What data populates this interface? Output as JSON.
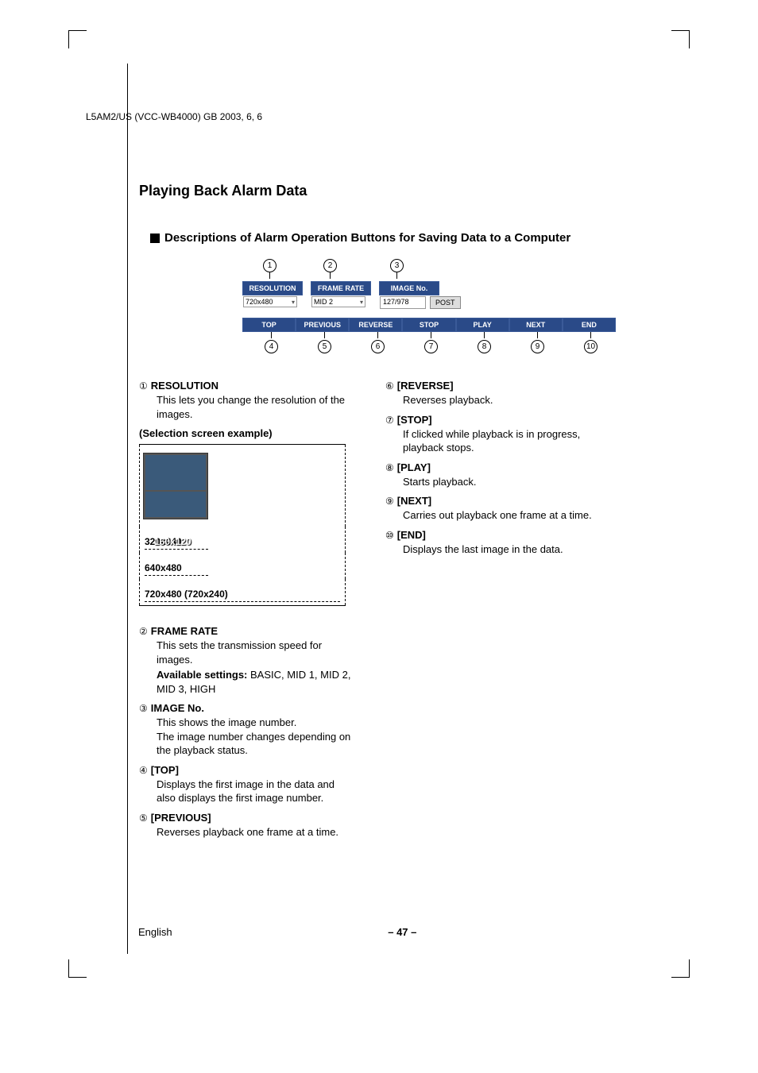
{
  "header_line": "L5AM2/US (VCC-WB4000)    GB    2003, 6, 6",
  "title": "Playing Back Alarm Data",
  "subtitle": "Descriptions of Alarm Operation Buttons for Saving Data to a Computer",
  "panel": {
    "resolution_label": "RESOLUTION",
    "resolution_value": "720x480",
    "framerate_label": "FRAME RATE",
    "framerate_value": "MID 2",
    "imageno_label": "IMAGE No.",
    "imageno_value": "127/978",
    "post_label": "POST",
    "buttons": [
      "TOP",
      "PREVIOUS",
      "REVERSE",
      "STOP",
      "PLAY",
      "NEXT",
      "END"
    ]
  },
  "markers_top": [
    "1",
    "2",
    "3"
  ],
  "markers_bot": [
    "4",
    "5",
    "6",
    "7",
    "8",
    "9",
    "10"
  ],
  "left_items": [
    {
      "num": "1",
      "title": "RESOLUTION",
      "body": "This lets you change the resolution of the images."
    },
    {
      "num": "2",
      "title": "FRAME RATE",
      "body": "This sets the transmission speed for images.",
      "avail_label": "Available settings:",
      "avail_vals": "BASIC, MID 1, MID 2, MID 3, HIGH"
    },
    {
      "num": "3",
      "title": "IMAGE No.",
      "body": "This shows the image number.\nThe image number changes depending on the playback status."
    },
    {
      "num": "4",
      "title": "[TOP]",
      "body": "Displays the first image in the data and also displays the first image number."
    },
    {
      "num": "5",
      "title": "[PREVIOUS]",
      "body": "Reverses playback one frame at a time."
    }
  ],
  "right_items": [
    {
      "num": "6",
      "title": "[REVERSE]",
      "body": "Reverses playback."
    },
    {
      "num": "7",
      "title": "[STOP]",
      "body": "If clicked while playback is in progress, playback stops."
    },
    {
      "num": "8",
      "title": "[PLAY]",
      "body": "Starts playback."
    },
    {
      "num": "9",
      "title": "[NEXT]",
      "body": "Carries out playback one frame at a time."
    },
    {
      "num": "10",
      "title": "[END]",
      "body": "Displays the last image in the data."
    }
  ],
  "selection_example_label": "(Selection screen example)",
  "resolutions": [
    "160x120",
    "320x240",
    "640x480",
    "720x480 (720x240)"
  ],
  "footer_lang": "English",
  "footer_page": "– 47 –",
  "circled_glyphs": {
    "1": "①",
    "2": "②",
    "3": "③",
    "4": "④",
    "5": "⑤",
    "6": "⑥",
    "7": "⑦",
    "8": "⑧",
    "9": "⑨",
    "10": "⑩"
  }
}
